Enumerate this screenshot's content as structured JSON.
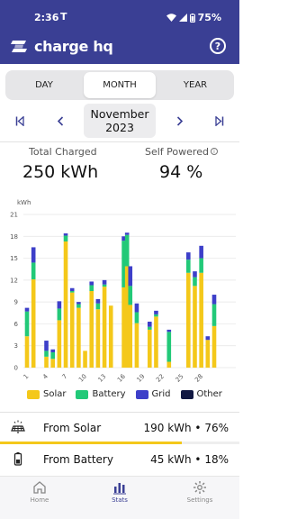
{
  "status_bar": {
    "time": "2:36",
    "notif_symbol": "T",
    "battery": "75%"
  },
  "header": {
    "app_name": "charge hq",
    "help_glyph": "?"
  },
  "period_tabs": [
    {
      "label": "DAY",
      "active": false
    },
    {
      "label": "MONTH",
      "active": true
    },
    {
      "label": "YEAR",
      "active": false
    }
  ],
  "date_nav": {
    "month": "November",
    "year": "2023"
  },
  "summary": {
    "total_label": "Total Charged",
    "total_value": "250 kWh",
    "self_label": "Self Powered",
    "self_value": "94 %"
  },
  "chart_data": {
    "type": "bar",
    "stacked": true,
    "ylabel": "kWh",
    "ylim": [
      0,
      21
    ],
    "yticks": [
      0,
      3,
      6,
      9,
      12,
      15,
      18,
      21
    ],
    "xticks": [
      "1",
      "4",
      "7",
      "10",
      "13",
      "16",
      "19",
      "22",
      "25",
      "28"
    ],
    "days": [
      1,
      2,
      3,
      4,
      5,
      6,
      7,
      8,
      9,
      10,
      11,
      12,
      13,
      14,
      15,
      16,
      16.5,
      17,
      18,
      19,
      20,
      21,
      22,
      23,
      24,
      25,
      26,
      27,
      28,
      29,
      30
    ],
    "series": [
      {
        "name": "Solar",
        "color": "#f4c81a",
        "values": [
          4.3,
          12.1,
          0,
          1.5,
          1.2,
          6.5,
          17.3,
          10.3,
          8.2,
          2.3,
          10.5,
          8.0,
          11.1,
          8.5,
          0,
          11.0,
          13.9,
          8.6,
          6.1,
          0,
          5.2,
          7.0,
          0,
          0.8,
          0,
          0,
          13.0,
          11.2,
          13.0,
          3.8,
          5.7
        ]
      },
      {
        "name": "Battery",
        "color": "#22c978",
        "values": [
          3.4,
          2.3,
          0,
          0.8,
          0.9,
          1.6,
          0.8,
          0.2,
          0.5,
          0,
          0.8,
          0.8,
          0.3,
          0,
          0,
          6.4,
          4.3,
          2.6,
          1.5,
          0,
          0.4,
          0.3,
          0,
          4.1,
          0,
          0,
          1.8,
          1.2,
          2.0,
          0,
          3.0
        ]
      },
      {
        "name": "Grid",
        "color": "#3d3fc9",
        "values": [
          0.5,
          2.1,
          0,
          1.4,
          0.4,
          1.0,
          0.3,
          0.4,
          0.3,
          0,
          0.5,
          0.6,
          0.6,
          0,
          0,
          0.6,
          0.3,
          2.7,
          1.2,
          0,
          0.7,
          0.5,
          0,
          0.3,
          0,
          0,
          1.0,
          0.8,
          1.7,
          0.5,
          1.3
        ]
      },
      {
        "name": "Other",
        "color": "#111842",
        "values": [
          0,
          0,
          0,
          0,
          0,
          0,
          0,
          0,
          0,
          0,
          0,
          0,
          0,
          0,
          0,
          0,
          0,
          0,
          0,
          0,
          0,
          0,
          0,
          0,
          0,
          0,
          0,
          0,
          0,
          0,
          0
        ]
      }
    ]
  },
  "breakdown": [
    {
      "label": "From Solar",
      "value": "190 kWh • 76%",
      "share": 0.76,
      "color": "#f4c81a"
    },
    {
      "label": "From Battery",
      "value": "45 kWh • 18%",
      "share": 0.18,
      "color": "#22c978"
    }
  ],
  "tabbar": [
    {
      "label": "Home",
      "active": false
    },
    {
      "label": "Stats",
      "active": true
    },
    {
      "label": "Settings",
      "active": false
    }
  ]
}
